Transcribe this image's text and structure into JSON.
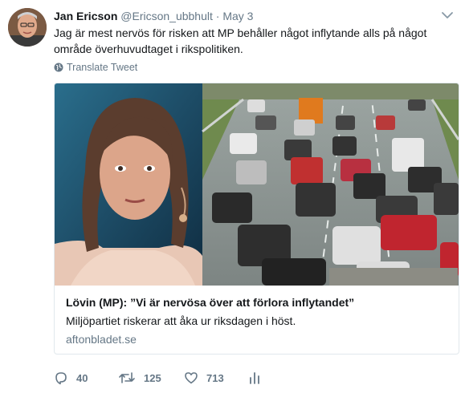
{
  "tweet": {
    "author_name": "Jan Ericson",
    "author_handle": "@Ericson_ubbhult",
    "separator": "·",
    "date": "May 3",
    "text": "Jag är mest nervös för risken att MP behåller något inflytande alls på något område överhuvudtaget i rikspolitiken.",
    "translate_label": "Translate Tweet"
  },
  "card": {
    "title": "Lövin (MP): ”Vi är nervösa över att förlora inflytandet”",
    "description": "Miljöpartiet riskerar att åka ur riksdagen i höst.",
    "domain": "aftonbladet.se"
  },
  "actions": {
    "replies": "40",
    "retweets": "125",
    "likes": "713"
  },
  "icons": {
    "chevron": "chevron-down-icon",
    "globe": "globe-icon",
    "reply": "reply-icon",
    "retweet": "retweet-icon",
    "like": "heart-icon",
    "analytics": "analytics-icon"
  },
  "colors": {
    "text": "#14171a",
    "secondary": "#657786",
    "border": "#e1e8ed"
  }
}
